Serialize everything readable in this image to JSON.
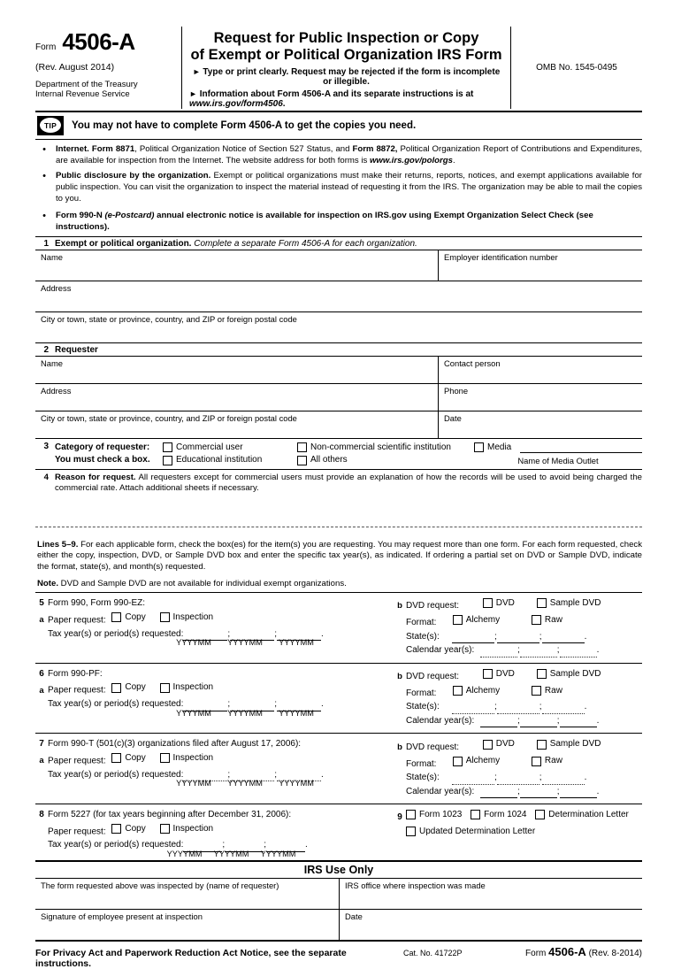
{
  "header": {
    "form_word": "Form",
    "form_number": "4506-A",
    "revision": "(Rev. August 2014)",
    "department_line1": "Department of the Treasury",
    "department_line2": "Internal Revenue Service",
    "title_line1": "Request for Public Inspection or Copy",
    "title_line2": "of Exempt or Political Organization IRS Form",
    "instruction1": "Type or print clearly. Request may be rejected if the form is incomplete or illegible.",
    "instruction2_pre": "Information about Form 4506-A and its separate instructions is at ",
    "instruction2_url": "www.irs.gov/form4506",
    "instruction2_post": ".",
    "omb": "OMB No. 1545-0495"
  },
  "tip": {
    "badge": "TIP",
    "text": "You may not have to complete Form 4506-A to get the copies you need."
  },
  "bullets": [
    {
      "b1": "Internet. Form 8871",
      "t1": ", Political Organization Notice of Section 527 Status, and ",
      "b2": "Form 8872,",
      "t2": " Political Organization Report of Contributions and Expenditures, are available for inspection from the Internet. The website address for both forms is ",
      "url": "www.irs.gov/polorgs",
      "t3": "."
    },
    {
      "b1": "Public disclosure by the organization.",
      "t1": " Exempt or political organizations must make their returns, reports, notices, and exempt applications available for public inspection. You can visit the organization to inspect the material instead of requesting it from the IRS. The organization may be able to mail the copies to you."
    },
    {
      "b1": "Form 990-N ",
      "ital": "(e-Postcard)",
      "t1": " annual electronic notice is available for inspection on IRS.gov using Exempt Organization Select Check (see instructions)."
    }
  ],
  "section1": {
    "number": "1",
    "heading_bold": "Exempt or political organization.",
    "heading_italic": " Complete a separate Form 4506-A for each organization.",
    "name_label": "Name",
    "ein_label": "Employer identification number",
    "address_label": "Address",
    "city_label": "City or town, state or province, country, and ZIP or foreign postal code"
  },
  "section2": {
    "number": "2",
    "heading": "Requester",
    "name_label": "Name",
    "contact_label": "Contact person",
    "address_label": "Address",
    "phone_label": "Phone",
    "city_label": "City or town, state or province, country, and ZIP or foreign postal code",
    "date_label": "Date"
  },
  "section3": {
    "number": "3",
    "label_line1": "Category of requester:",
    "label_line2": "You must check a box.",
    "options_row1": [
      "Commercial user",
      "Non-commercial scientific institution",
      "Media"
    ],
    "options_row2": [
      "Educational institution",
      "All others"
    ],
    "media_outlet_caption": "Name of Media Outlet"
  },
  "section4": {
    "number": "4",
    "heading": "Reason for request.",
    "text": "  All requesters except for commercial users must provide an explanation of how the records will be used to avoid being charged the commercial rate. Attach additional sheets if necessary."
  },
  "lines_intro": {
    "bold": "Lines 5–9.",
    "text": " For each applicable form, check the box(es) for the item(s) you are requesting. You may request more than one form. For each form requested, check either the copy, inspection, DVD, or Sample DVD box and enter the specific tax year(s), as indicated. If ordering a partial set on DVD or Sample DVD, indicate the format, state(s), and month(s) requested.",
    "note_bold": "Note.",
    "note_text": " DVD and Sample DVD are not available for individual exempt organizations."
  },
  "common": {
    "paper_request": "Paper request:",
    "copy": "Copy",
    "inspection": "Inspection",
    "tax_years": "Tax year(s) or period(s) requested:",
    "yyyymm": "YYYYMM",
    "semicolon": ";",
    "period": ".",
    "sub_a": "a",
    "sub_b": "b",
    "dvd_request": "DVD request:",
    "dvd": "DVD",
    "sample_dvd": "Sample DVD",
    "format": "Format:",
    "alchemy": "Alchemy",
    "raw": "Raw",
    "states": "State(s):",
    "calendar_years": "Calendar year(s):"
  },
  "lines": [
    {
      "number": "5",
      "title": "Form 990, Form 990-EZ:"
    },
    {
      "number": "6",
      "title": "Form 990-PF:"
    },
    {
      "number": "7",
      "title": "Form 990-T (501(c)(3) organizations filed after August 17, 2006):"
    }
  ],
  "line8": {
    "number": "8",
    "title": "Form 5227 (for tax years beginning after December 31, 2006):"
  },
  "line9": {
    "number": "9",
    "options_row1": [
      "Form 1023",
      "Form 1024",
      "Determination Letter"
    ],
    "options_row2": [
      "Updated Determination Letter"
    ]
  },
  "irs_use": {
    "heading": "IRS Use Only",
    "inspected_by_label": "The form requested above was inspected by (name of requester)",
    "office_label": "IRS office where inspection was made",
    "signature_label": "Signature of employee present at inspection",
    "date_label": "Date"
  },
  "footer": {
    "privacy": "For Privacy Act and Paperwork Reduction Act Notice, see the separate instructions.",
    "cat_no": "Cat. No. 41722P",
    "form_word": "Form",
    "form_number": "4506-A",
    "rev": " (Rev. 8-2014)"
  }
}
